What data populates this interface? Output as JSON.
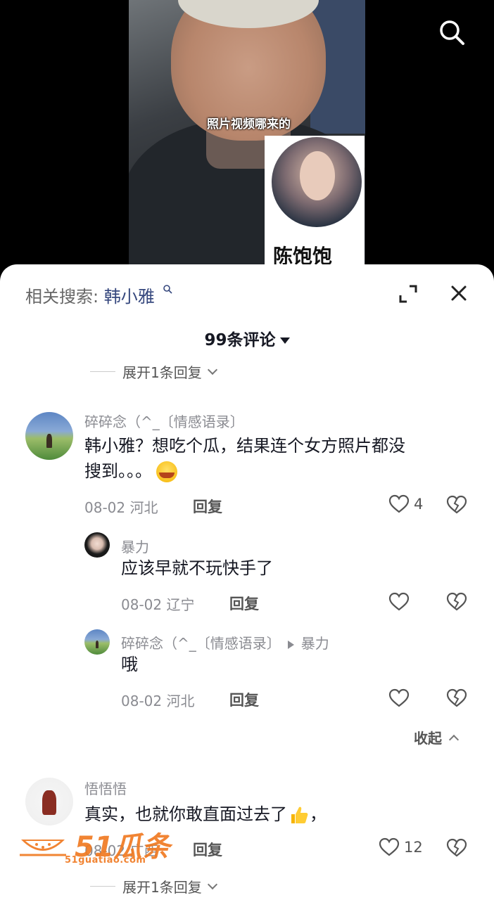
{
  "video": {
    "caption": "照片视频哪来的",
    "pip_name": "陈饱饱"
  },
  "sheet": {
    "related_label": "相关搜索:",
    "related_term": "韩小雅",
    "comment_count": "99条评论"
  },
  "expand_top": "展开1条回复",
  "comments": [
    {
      "user": "碎碎念（^_〔情感语录〕",
      "text_line1": "韩小雅？想吃个瓜，结果连个女方照片都没",
      "text_line2": "搜到。。。",
      "date": "08-02 河北",
      "reply": "回复",
      "likes": "4"
    },
    {
      "user": "暴力",
      "text": "应该早就不玩快手了",
      "date": "08-02 辽宁",
      "reply": "回复"
    },
    {
      "user": "碎碎念（^_〔情感语录〕",
      "reply_to": "暴力",
      "text": "哦",
      "date": "08-02 河北",
      "reply": "回复"
    },
    {
      "user": "悟悟悟",
      "text": "真实，也就你敢直面过去了",
      "text_tail": "，",
      "date": "08-02 广西",
      "reply": "回复",
      "likes": "12"
    }
  ],
  "collapse": "收起",
  "expand_bottom": "展开1条回复",
  "watermark": {
    "brand": "51瓜条",
    "url": "51guatiao.com"
  },
  "icons": [
    "search-icon",
    "search-small-icon",
    "fullscreen-icon",
    "close-icon",
    "heart-icon",
    "broken-heart-icon",
    "crying-laugh-emoji",
    "thumbs-up-emoji"
  ],
  "colors": {
    "accent_blue": "#35477d",
    "watermark_orange": "#f07a22"
  }
}
